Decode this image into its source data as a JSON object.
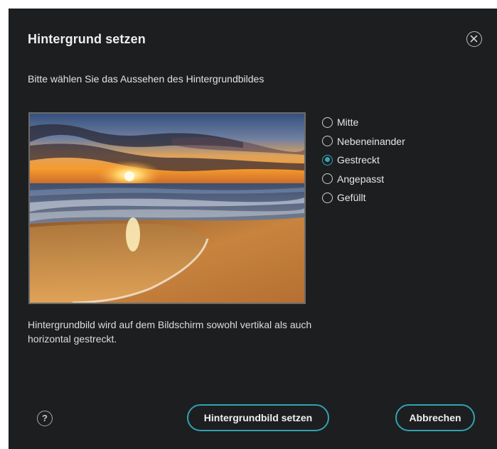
{
  "dialog": {
    "title": "Hintergrund setzen",
    "subtitle": "Bitte wählen Sie das Aussehen des Hintergrundbildes",
    "close_icon": "close-circle-icon",
    "preview_image": "sunset-beach-wallpaper",
    "options": [
      {
        "label": "Mitte",
        "checked": false
      },
      {
        "label": "Nebeneinander",
        "checked": false
      },
      {
        "label": "Gestreckt",
        "checked": true
      },
      {
        "label": "Angepasst",
        "checked": false
      },
      {
        "label": "Gefüllt",
        "checked": false
      }
    ],
    "description": "Hintergrundbild wird auf dem Bildschirm sowohl vertikal als auch horizontal gestreckt.",
    "help_icon": "question-mark-icon",
    "help_glyph": "?",
    "primary_button": "Hintergrundbild setzen",
    "cancel_button": "Abbrechen",
    "accent_color": "#2fa3b3",
    "background_color": "#1d1e20"
  }
}
